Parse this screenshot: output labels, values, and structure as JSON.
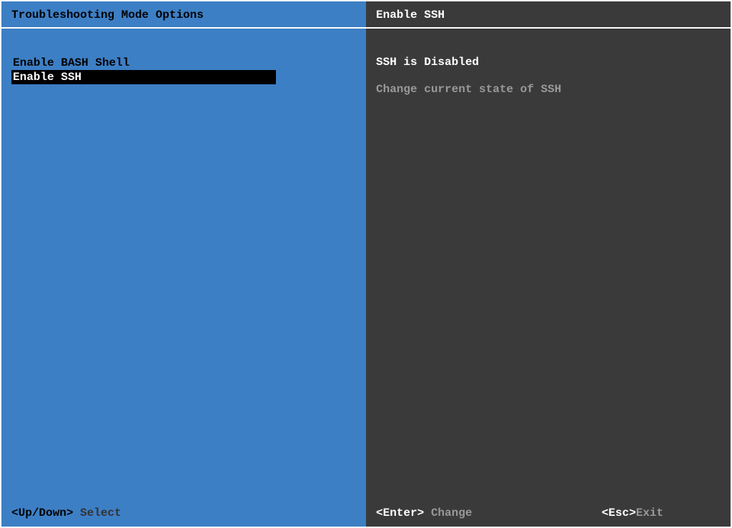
{
  "left": {
    "title": "Troubleshooting Mode Options",
    "menu": [
      {
        "label": "Enable BASH Shell",
        "selected": false
      },
      {
        "label": "Enable SSH",
        "selected": true
      }
    ],
    "footer": {
      "key": "<Up/Down>",
      "action": " Select"
    }
  },
  "right": {
    "title": "Enable SSH",
    "status": "SSH is Disabled",
    "description": "Change current state of SSH",
    "footer": {
      "enter_key": "<Enter>",
      "enter_action": " Change",
      "esc_key": "<Esc>",
      "esc_action": "Exit"
    }
  }
}
